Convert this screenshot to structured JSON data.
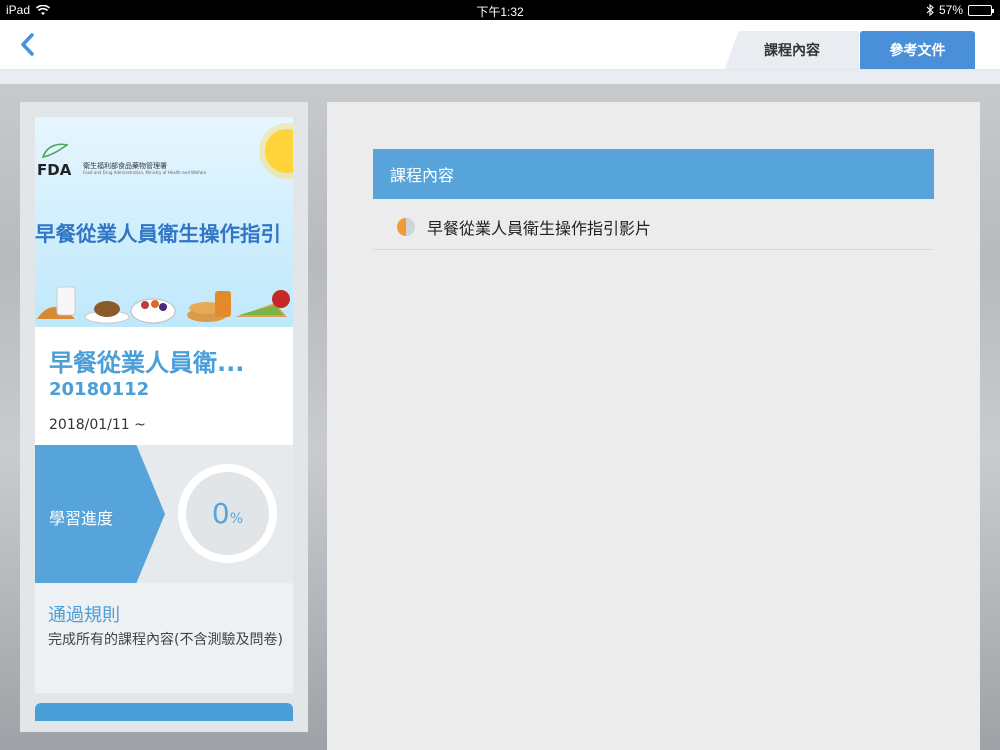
{
  "status_bar": {
    "device": "iPad",
    "time": "下午1:32",
    "battery": "57%",
    "battery_level": 0.57
  },
  "nav": {
    "tabs": [
      {
        "label": "課程內容"
      },
      {
        "label": "參考文件"
      }
    ]
  },
  "course": {
    "banner": {
      "logo": "FDA",
      "agency_name": "衛生福利部食品藥物管理署",
      "agency_sub": "Food and Drug Administration, Ministry of Health and Welfare",
      "title": "早餐從業人員衛生操作指引"
    },
    "title": "早餐從業人員衛...",
    "code": "20180112",
    "date": "2018/01/11 ~",
    "progress_label": "學習進度",
    "progress_value": "0",
    "progress_unit": "%",
    "rules_title": "通過規則",
    "rules_text": "完成所有的課程內容(不含測驗及問卷)"
  },
  "main": {
    "section_title": "課程內容",
    "items": [
      {
        "label": "早餐從業人員衛生操作指引影片",
        "status": "in-progress"
      }
    ]
  },
  "colors": {
    "accent": "#56a4da",
    "tab_active": "#4a90d9",
    "status_partial": "#f29a38"
  }
}
